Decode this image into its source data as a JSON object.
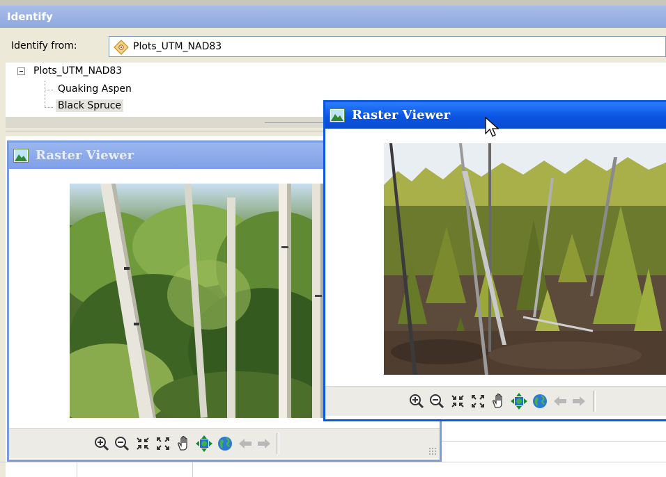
{
  "identify": {
    "title": "Identify",
    "from_label": "Identify from:",
    "from_value": "Plots_UTM_NAD83",
    "tree": {
      "root": "Plots_UTM_NAD83",
      "children": [
        "Quaking Aspen",
        "Black Spruce"
      ],
      "selected_child": "Black Spruce"
    }
  },
  "raster_viewer_back": {
    "title": "Raster Viewer",
    "photo": "aspen-forest-photo"
  },
  "raster_viewer_front": {
    "title": "Raster Viewer",
    "photo": "black-spruce-bog-photo"
  },
  "toolbar_icons": [
    "zoom-in-icon",
    "zoom-out-icon",
    "fixed-zoom-in-icon",
    "fixed-zoom-out-icon",
    "pan-icon",
    "full-extent-icon",
    "globe-icon",
    "back-arrow-icon",
    "forward-arrow-icon"
  ],
  "colors": {
    "active_title": "#0a55e2",
    "inactive_title": "#7f9fe6",
    "identify_title": "#8ea8df",
    "panel_bg": "#ece9d8"
  }
}
